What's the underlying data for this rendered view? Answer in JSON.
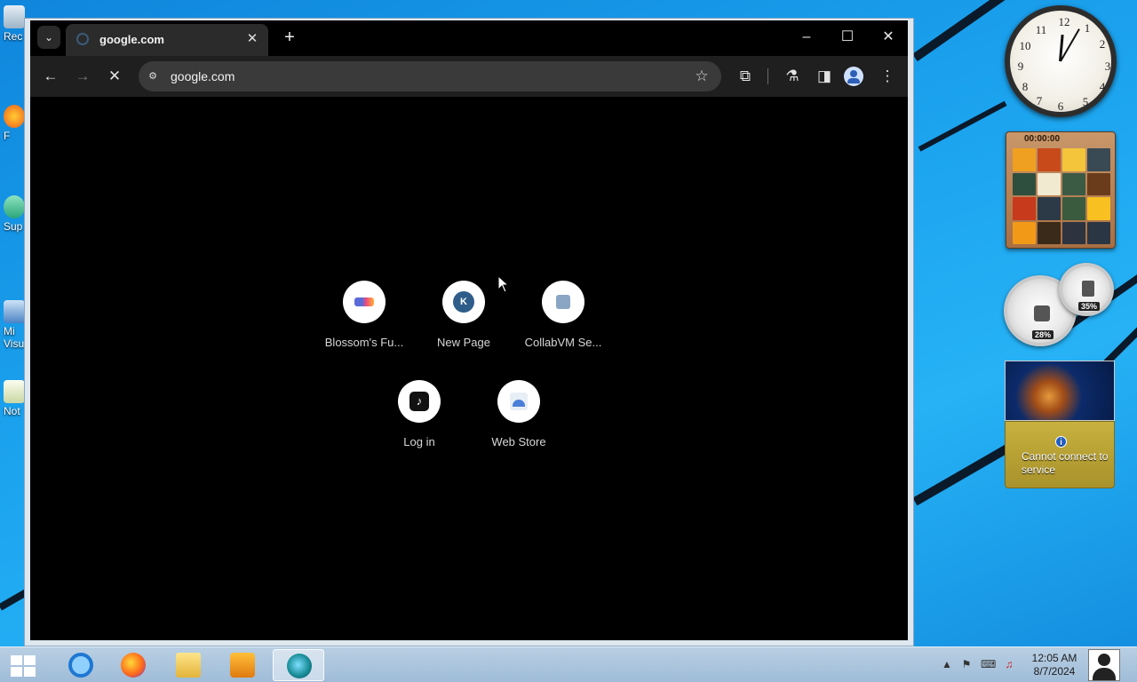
{
  "browser": {
    "tab_title": "google.com",
    "address": "google.com",
    "tab_close_label": "✕",
    "new_tab_label": "+",
    "shortcuts": [
      {
        "label": "Blossom's Fu...",
        "icon": "blossom-favicon-icon"
      },
      {
        "label": "New Page",
        "icon": "letter-k-icon",
        "letter": "K"
      },
      {
        "label": "CollabVM Se...",
        "icon": "collabvm-favicon-icon"
      },
      {
        "label": "Log in",
        "icon": "tiktok-icon"
      },
      {
        "label": "Web Store",
        "icon": "webstore-icon"
      }
    ]
  },
  "gadgets": {
    "puzzle_timer": "00:00:00",
    "cpu_percent": "28%",
    "memory_percent": "35%",
    "weather_message": "Cannot connect to service",
    "weather_info": "i"
  },
  "desktop_icons": [
    {
      "label": "Rec"
    },
    {
      "label": "F"
    },
    {
      "label": "Sup"
    },
    {
      "label": "Mi Visu"
    },
    {
      "label": "Not"
    }
  ],
  "taskbar": {
    "time": "12:05 AM",
    "date": "8/7/2024",
    "apps": [
      "internet-explorer-icon",
      "firefox-icon",
      "file-explorer-icon",
      "media-player-icon",
      "chromium-icon"
    ]
  },
  "colors": {
    "accent": "#1a9be8",
    "browser_chrome": "#1f1f1f",
    "content_bg": "#000000"
  }
}
